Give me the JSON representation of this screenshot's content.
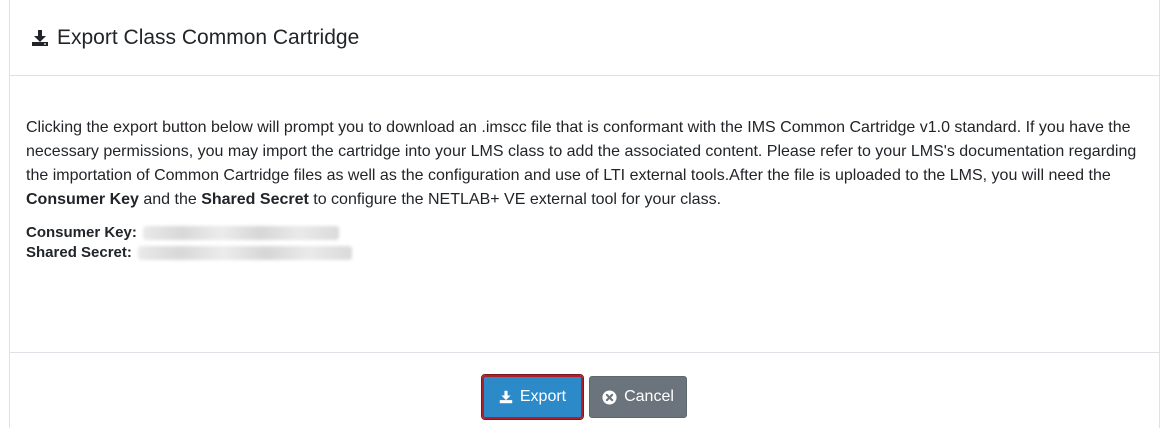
{
  "dialog": {
    "title": "Export Class Common Cartridge",
    "icon": "download-icon"
  },
  "body": {
    "desc_part1": "Clicking the export button below will prompt you to download an .imscc file that is conformant with the IMS Common Cartridge v1.0 standard. If you have the necessary permissions, you may import the cartridge into your LMS class to add the associated content. Please refer to your LMS's documentation regarding the importation of Common Cartridge files as well as the configuration and use of LTI external tools.After the file is uploaded to the LMS, you will need the ",
    "desc_bold1": "Consumer Key",
    "desc_part2": " and the ",
    "desc_bold2": "Shared Secret",
    "desc_part3": " to configure the NETLAB+ VE external tool for your class.",
    "consumer_key_label": "Consumer Key:",
    "shared_secret_label": "Shared Secret:"
  },
  "footer": {
    "export_label": "Export",
    "cancel_label": "Cancel"
  },
  "colors": {
    "export_button": "#2d8ac8",
    "export_highlight_border": "#b0202a",
    "cancel_button": "#6b747c"
  }
}
